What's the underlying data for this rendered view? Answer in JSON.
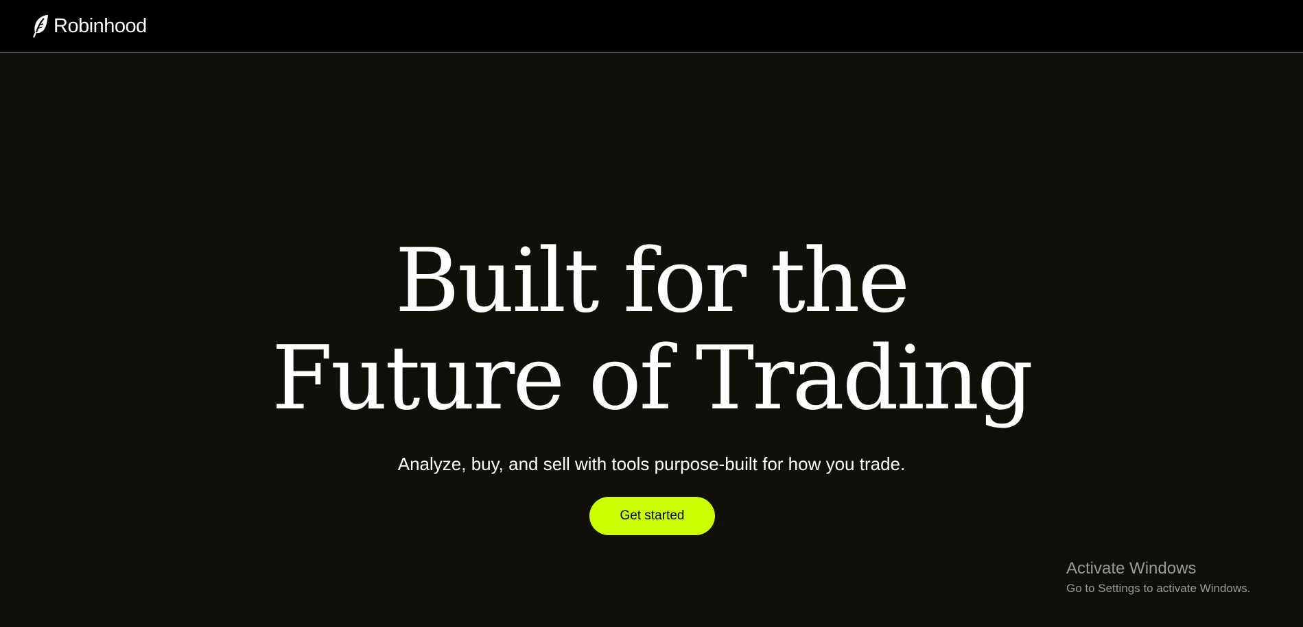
{
  "header": {
    "brand": "Robinhood",
    "logo_icon": "feather-icon",
    "background": "#000000"
  },
  "hero": {
    "headline_line1": "Built for the",
    "headline_line2": "Future of Trading",
    "subtitle": "Analyze, buy, and sell with tools purpose-built for how you trade.",
    "cta_label": "Get started",
    "background": "#110f0a",
    "accent": "#ccff00"
  },
  "watermark": {
    "title": "Activate Windows",
    "subtitle": "Go to Settings to activate Windows."
  }
}
